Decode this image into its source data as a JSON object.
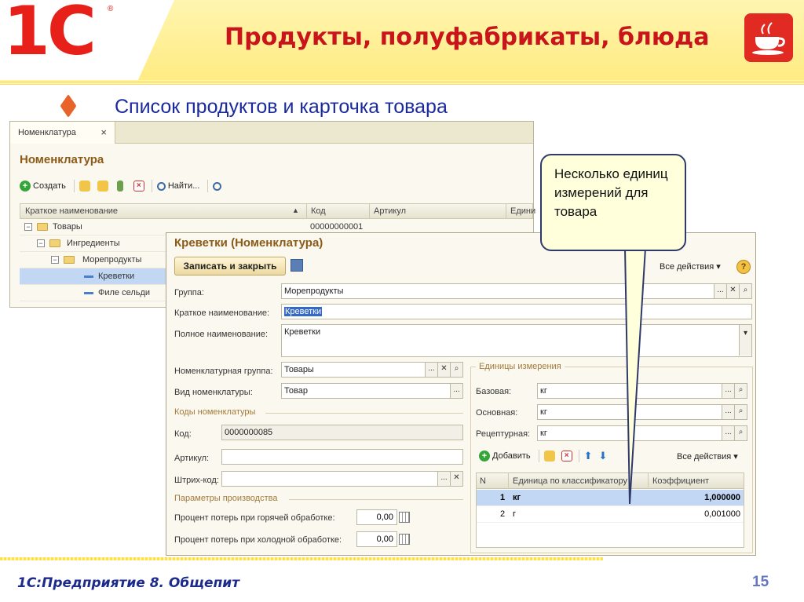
{
  "header": {
    "logo": "1С",
    "logo_reg": "®",
    "title": "Продукты, полуфабрикаты, блюда"
  },
  "subtitle": "Список продуктов и карточка товара",
  "list_window": {
    "tab_label": "Номенклатура",
    "tab_close": "×",
    "title": "Номенклатура",
    "toolbar": {
      "create": "Создать",
      "find": "Найти..."
    },
    "columns": [
      "Краткое наименование",
      "Код",
      "Артикул",
      "Едини"
    ],
    "rows": [
      {
        "name": "Товары",
        "code": "00000000001"
      },
      {
        "name": "Ингредиенты",
        "code": ""
      },
      {
        "name": "Морепродукты",
        "code": ""
      },
      {
        "name": "Креветки",
        "code": ""
      },
      {
        "name": "Филе сельди",
        "code": ""
      }
    ]
  },
  "card": {
    "title": "Креветки (Номенклатура)",
    "save_close": "Записать и закрыть",
    "all_actions": "Все действия ▾",
    "help": "?",
    "group_label": "Группа:",
    "group_value": "Морепродукты",
    "short_name_label": "Краткое наименование:",
    "short_name_value": "Креветки",
    "full_name_label": "Полное наименование:",
    "full_name_value": "Креветки",
    "nom_group_label": "Номенклатурная группа:",
    "nom_group_value": "Товары",
    "nom_type_label": "Вид номенклатуры:",
    "nom_type_value": "Товар",
    "codes_section": "Коды номенклатуры",
    "code_label": "Код:",
    "code_value": "0000000085",
    "article_label": "Артикул:",
    "barcode_label": "Штрих-код:",
    "production_section": "Параметры производства",
    "loss_hot_label": "Процент потерь при горячей обработке:",
    "loss_hot_value": "0,00",
    "loss_cold_label": "Процент потерь при холодной обработке:",
    "loss_cold_value": "0,00",
    "units_section": "Единицы измерения",
    "base_label": "Базовая:",
    "base_value": "кг",
    "main_label": "Основная:",
    "main_value": "кг",
    "recipe_label": "Рецептурная:",
    "recipe_value": "кг",
    "add_label": "Добавить",
    "units_all_actions": "Все действия ▾",
    "units_columns": [
      "N",
      "Единица по классификатору",
      "Коэффициент"
    ],
    "units_rows": [
      {
        "n": "1",
        "unit": "кг",
        "coef": "1,000000"
      },
      {
        "n": "2",
        "unit": "г",
        "coef": "0,001000"
      }
    ]
  },
  "callout": "Несколько единиц измерений для товара",
  "footer": {
    "text": "1С:Предприятие 8. Общепит",
    "page": "15"
  },
  "colors": {
    "title_red": "#c8141a",
    "subtitle_blue": "#1a2a9c",
    "selection": "#c2d7f4"
  }
}
